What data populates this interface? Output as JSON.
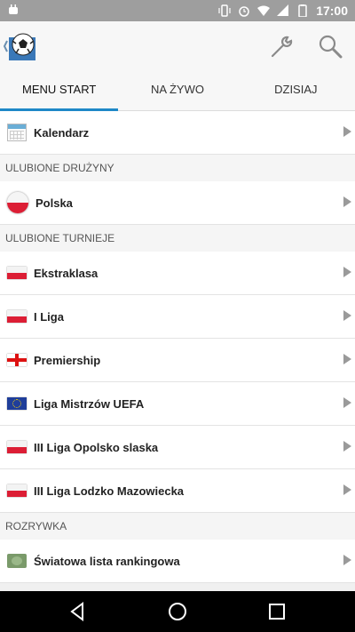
{
  "status_bar": {
    "time": "17:00"
  },
  "tabs": [
    "MENU START",
    "NA ŻYWO",
    "DZISIAJ"
  ],
  "calendar": {
    "label": "Kalendarz"
  },
  "sections": {
    "favorite_teams": "ULUBIONE DRUŻYNY",
    "favorite_tournaments": "ULUBIONE TURNIEJE",
    "entertainment": "ROZRYWKA"
  },
  "favorite_teams": [
    {
      "label": "Polska",
      "icon": "poland-flag-icon"
    }
  ],
  "favorite_tournaments": [
    {
      "label": "Ekstraklasa",
      "icon": "poland-flag-icon"
    },
    {
      "label": "I Liga",
      "icon": "poland-flag-icon"
    },
    {
      "label": "Premiership",
      "icon": "england-flag-icon"
    },
    {
      "label": "Liga Mistrzów UEFA",
      "icon": "eu-flag-icon"
    },
    {
      "label": "III Liga Opolsko slaska",
      "icon": "poland-flag-icon"
    },
    {
      "label": "III Liga Lodzko Mazowiecka",
      "icon": "poland-flag-icon"
    }
  ],
  "entertainment": [
    {
      "label": "Światowa lista rankingowa",
      "icon": "money-icon"
    }
  ],
  "colors": {
    "accent": "#1e88c7",
    "status_bar": "#9e9e9e",
    "background": "#f0f0f0"
  }
}
